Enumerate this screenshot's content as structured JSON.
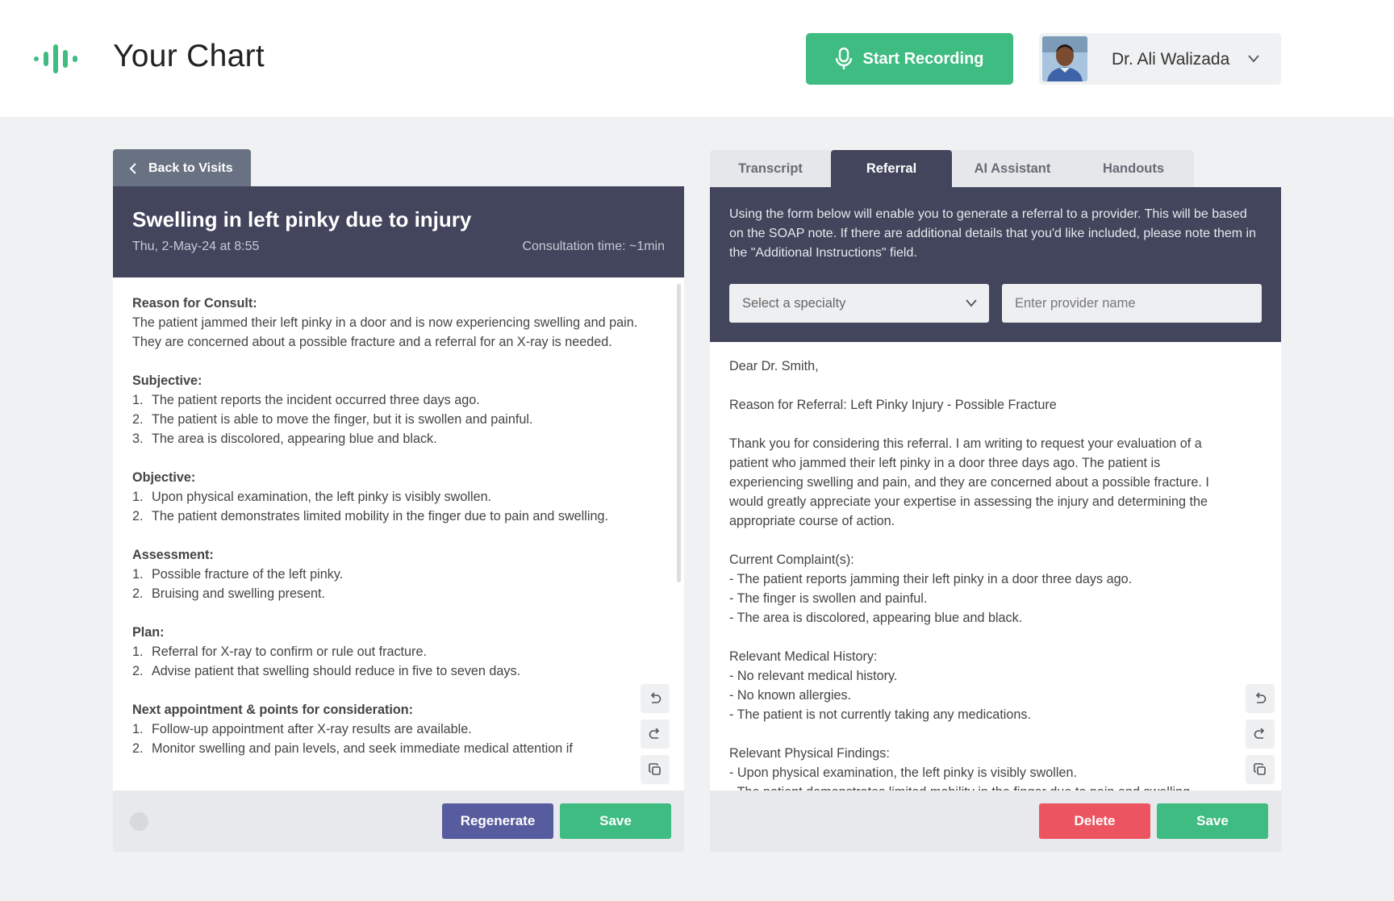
{
  "header": {
    "title": "Your Chart",
    "record_label": "Start Recording",
    "user_name": "Dr. Ali Walizada"
  },
  "colors": {
    "accent_green": "#3ebc81",
    "header_navy": "#42455c",
    "regenerate": "#575c9e",
    "delete": "#ec5461"
  },
  "left": {
    "back_label": "Back to Visits",
    "title": "Swelling in left pinky due to injury",
    "date": "Thu, 2-May-24 at 8:55",
    "consult_time": "Consultation time: ~1min",
    "sections": [
      {
        "title": "Reason for Consult:",
        "text": "The patient jammed their left pinky in a door and is now experiencing swelling and pain. They are concerned about a possible fracture and a referral for an X-ray is needed."
      },
      {
        "title": "Subjective:",
        "items": [
          "The patient reports the incident occurred three days ago.",
          "The patient is able to move the finger, but it is swollen and painful.",
          "The area is discolored, appearing blue and black."
        ]
      },
      {
        "title": "Objective:",
        "items": [
          "Upon physical examination, the left pinky is visibly swollen.",
          "The patient demonstrates limited mobility in the finger due to pain and swelling."
        ]
      },
      {
        "title": "Assessment:",
        "items": [
          "Possible fracture of the left pinky.",
          "Bruising and swelling present."
        ]
      },
      {
        "title": "Plan:",
        "items": [
          "Referral for X-ray to confirm or rule out fracture.",
          "Advise patient that swelling should reduce in five to seven days."
        ]
      },
      {
        "title": "Next appointment & points for consideration:",
        "items": [
          "Follow-up appointment after X-ray results are available.",
          "Monitor swelling and pain levels, and seek immediate medical attention if"
        ]
      }
    ],
    "regenerate_label": "Regenerate",
    "save_label": "Save"
  },
  "right": {
    "tabs": [
      "Transcript",
      "Referral",
      "AI Assistant",
      "Handouts"
    ],
    "active_tab": "Referral",
    "description": "Using the form below will enable you to generate a referral to a provider. This will be based on the SOAP note. If there are additional details that you'd like included, please note them in the \"Additional Instructions\" field.",
    "specialty_placeholder": "Select a specialty",
    "provider_placeholder": "Enter provider name",
    "letter": "Dear Dr. Smith,\n\nReason for Referral: Left Pinky Injury - Possible Fracture\n\nThank you for considering this referral. I am writing to request your evaluation of a patient who jammed their left pinky in a door three days ago. The patient is experiencing swelling and pain, and they are concerned about a possible fracture. I would greatly appreciate your expertise in assessing the injury and determining the appropriate course of action.\n\nCurrent Complaint(s):\n- The patient reports jamming their left pinky in a door three days ago.\n- The finger is swollen and painful.\n- The area is discolored, appearing blue and black.\n\nRelevant Medical History:\n- No relevant medical history.\n- No known allergies.\n- The patient is not currently taking any medications.\n\nRelevant Physical Findings:\n- Upon physical examination, the left pinky is visibly swollen.\n- The patient demonstrates limited mobility in the finger due to pain and swelling.",
    "delete_label": "Delete",
    "save_label": "Save"
  }
}
